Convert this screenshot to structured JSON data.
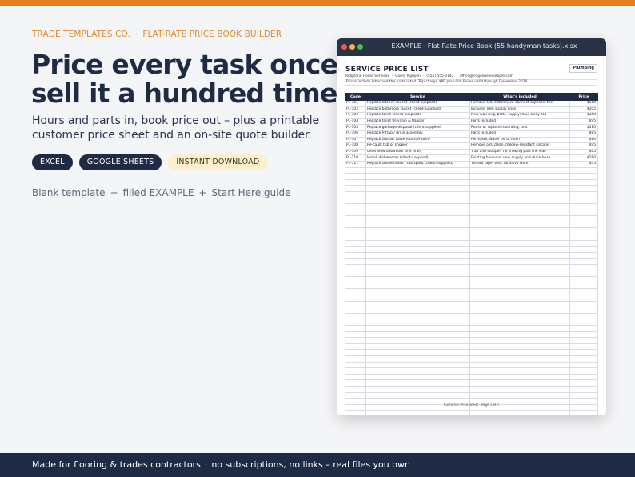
{
  "brand": "TRADE TEMPLATES CO.",
  "product": "FLAT-RATE PRICE BOOK BUILDER",
  "eyebrow_separator": "·",
  "headline": [
    "Price every task once,",
    "sell it a hundred times"
  ],
  "subtitle": [
    "Hours and parts in, book price out – plus a printable",
    "customer price sheet and an on-site quote builder."
  ],
  "badges": [
    {
      "label": "EXCEL"
    },
    {
      "label": "GOOGLE SHEETS"
    },
    {
      "label": "INSTANT DOWNLOAD"
    }
  ],
  "includes": {
    "items": [
      "Blank template",
      "filled EXAMPLE",
      "Start Here guide"
    ],
    "separator": "+"
  },
  "window": {
    "title": "EXAMPLE - Flat-Rate Price Book (55 handyman tasks).xlsx",
    "sheet": {
      "title": "SERVICE PRICE LIST",
      "trade": "Plumbing",
      "company": "Ridgeline Home Services",
      "contact": "Casey Nguyen",
      "phone": "(555) 555-0142",
      "email": "office@ridgeline.example.com",
      "info_separator": "·",
      "note": "Prices include labor and the parts listed. Trip charge $89 per visit. Prices valid through December 2026.",
      "columns": [
        "Code",
        "Service",
        "What's included",
        "Price"
      ],
      "rows": [
        [
          "PL-101",
          "Replace kitchen faucet (client-supplied)",
          "Remove old, install new, connect supplies, test",
          "$110"
        ],
        [
          "PL-102",
          "Replace bathroom faucet (client-supplied)",
          "Includes new supply lines",
          "$105"
        ],
        [
          "PL-103",
          "Replace toilet (client-supplied)",
          "New wax ring, bolts, supply; haul away old",
          "$150"
        ],
        [
          "PL-104",
          "Replace toilet fill valve & flapper",
          "Parts included",
          "$95"
        ],
        [
          "PL-105",
          "Replace garbage disposal (client-supplied)",
          "Reuse or replace mounting; test",
          "$110"
        ],
        [
          "PL-106",
          "Replace P-trap / drain assembly",
          "Parts included",
          "$85"
        ],
        [
          "PL-107",
          "Replace shutoff valve (quarter-turn)",
          "Per valve; water off at main",
          "$80"
        ],
        [
          "PL-108",
          "Re-caulk tub or shower",
          "Remove old, clean, mildew-resistant silicone",
          "$95"
        ],
        [
          "PL-109",
          "Clear slow bathroom sink drain",
          "Trap and stopper; no snaking past the wall",
          "$65"
        ],
        [
          "PL-110",
          "Install dishwasher (client-supplied)",
          "Existing hookups; new supply and drain hose",
          "$180"
        ],
        [
          "PL-111",
          "Replace showerhead / tub spout (client-supplied)",
          "Thread tape; test; no valve work",
          "$45"
        ]
      ],
      "footer": "Customer Price Sheet  ·  Page 1 of 7"
    }
  },
  "footer": {
    "items": [
      "Made for flooring & trades contractors",
      "no subscriptions, no links – real files you own"
    ],
    "separator": "·"
  },
  "colors": {
    "accent": "#e97c23",
    "navy": "#1f2a44",
    "badge_light": "#fbf0c9"
  }
}
